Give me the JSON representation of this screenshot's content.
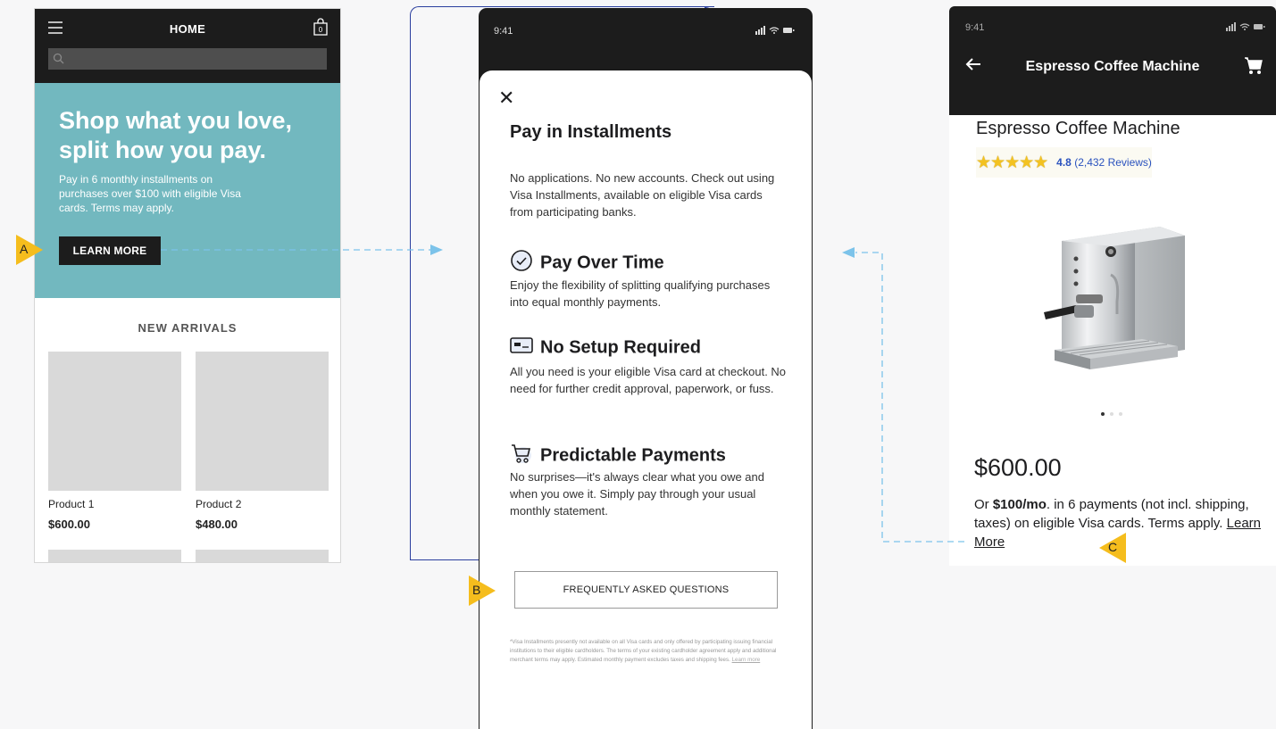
{
  "left_screen": {
    "header_title": "HOME",
    "cart_count": "0",
    "hero": {
      "headline": "Shop what you love, split how you pay.",
      "body": "Pay in 6 monthly installments on purchases over $100 with eligible Visa cards. Terms may apply.",
      "button": "LEARN MORE"
    },
    "section_title": "NEW ARRIVALS",
    "products": [
      {
        "name": "Product 1",
        "price": "$600.00"
      },
      {
        "name": "Product 2",
        "price": "$480.00"
      }
    ]
  },
  "middle_screen": {
    "time": "9:41",
    "close": "✕",
    "title": "Pay in Installments",
    "intro": "No applications. No new accounts. Check out using Visa Installments, available on eligible Visa cards from participating banks.",
    "features": [
      {
        "icon": "check-circle-icon",
        "title": "Pay Over Time",
        "body": "Enjoy the flexibility of splitting qualifying purchases into equal monthly payments."
      },
      {
        "icon": "card-icon",
        "title": "No Setup Required",
        "body": "All you need is your eligible Visa card at checkout. No need for further credit approval, paperwork, or fuss."
      },
      {
        "icon": "cart-icon",
        "title": "Predictable Payments",
        "body": "No surprises—it's always clear what you owe and when you owe it. Simply pay through your usual monthly statement."
      }
    ],
    "faq_button": "FREQUENTLY ASKED QUESTIONS",
    "disclaimer": "*Visa Installments presently not available on all Visa cards and only offered by participating issuing financial institutions to their eligible cardholders. The terms of your existing cardholder agreement apply and additional merchant terms may apply. Estimated monthly payment excludes taxes and shipping fees.",
    "disclaimer_link": "Learn more"
  },
  "right_screen": {
    "time": "9:41",
    "header_title": "Espresso Coffee Machine",
    "product_name": "Espresso Coffee Machine",
    "rating": "4.8",
    "reviews": "(2,432 Reviews)",
    "price": "$600.00",
    "terms_prefix": "Or ",
    "terms_amount": "$100/mo",
    "terms_rest": ". in 6 payments (not incl. shipping, taxes) on eligible Visa cards. Terms apply. ",
    "terms_link": "Learn More",
    "image_dots": 3,
    "image_active": 1
  },
  "callouts": [
    "A",
    "B",
    "C"
  ],
  "colors": {
    "hero": "#72b8bf",
    "dark": "#1c1c1c",
    "callout": "#f5bd1d",
    "dashed_arrow": "#7cc3ea",
    "frame_outline": "#2a3e9e",
    "link": "#2a52be",
    "stars": "#f3c221"
  }
}
